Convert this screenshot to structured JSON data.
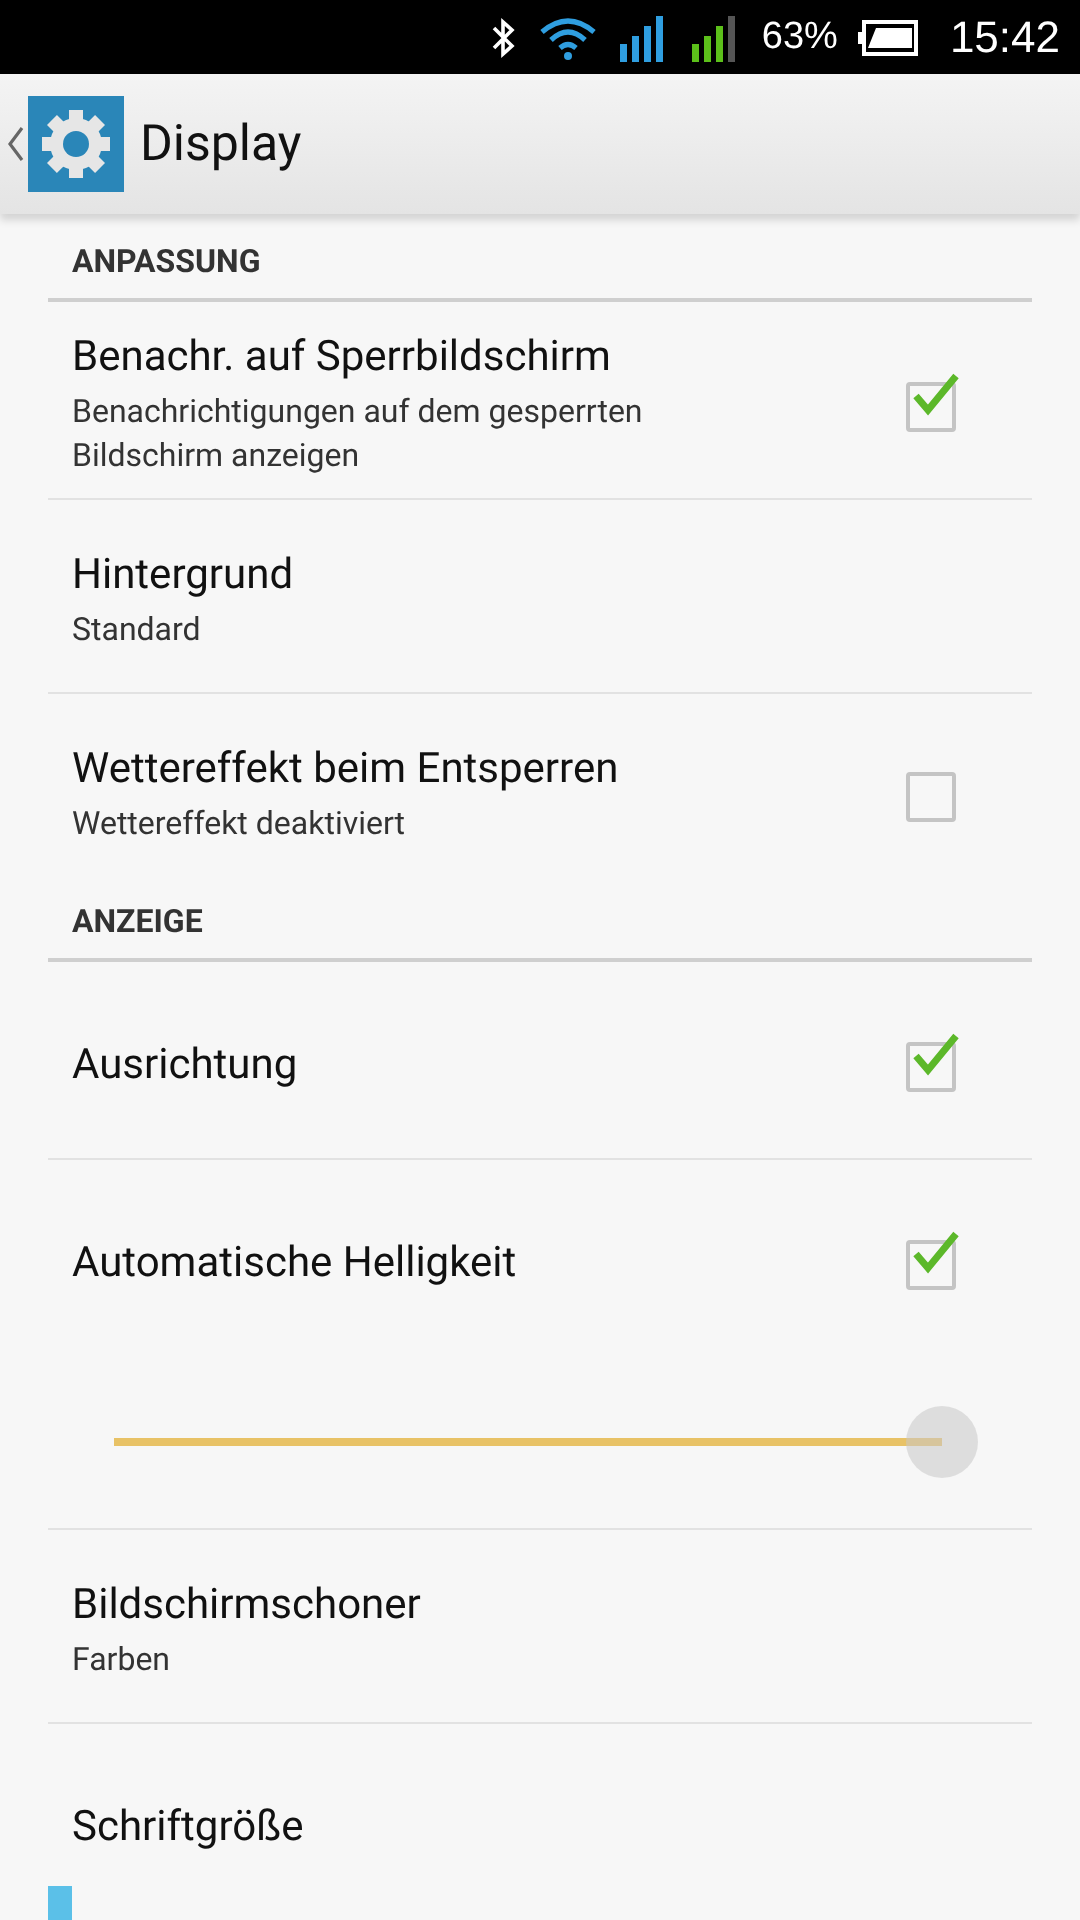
{
  "status_bar": {
    "battery_percent": "63%",
    "time": "15:42"
  },
  "action_bar": {
    "title": "Display"
  },
  "sections": [
    {
      "header": "ANPASSUNG",
      "items": [
        {
          "kind": "checkbox",
          "title": "Benachr. auf Sperrbildschirm",
          "summary": "Benachrichtigungen auf dem gesperrten Bildschirm anzeigen",
          "checked": true
        },
        {
          "kind": "text",
          "title": "Hintergrund",
          "summary": "Standard"
        },
        {
          "kind": "checkbox",
          "title": "Wettereffekt beim Entsperren",
          "summary": "Wettereffekt deaktiviert",
          "checked": false
        }
      ]
    },
    {
      "header": "ANZEIGE",
      "items": [
        {
          "kind": "checkbox",
          "title": "Ausrichtung",
          "checked": true
        },
        {
          "kind": "checkbox",
          "title": "Automatische Helligkeit",
          "checked": true
        },
        {
          "kind": "slider",
          "level": 1
        },
        {
          "kind": "text",
          "title": "Bildschirmschoner",
          "summary": "Farben"
        },
        {
          "kind": "text",
          "title": "Schriftgröße"
        }
      ]
    }
  ]
}
